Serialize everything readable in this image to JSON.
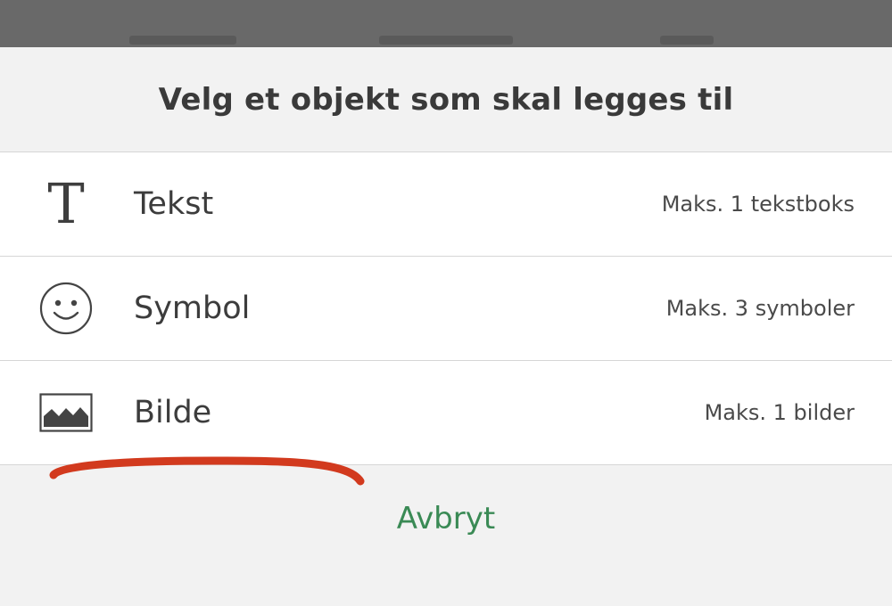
{
  "sheet": {
    "title": "Velg et objekt som skal legges til",
    "options": [
      {
        "label": "Tekst",
        "limit": "Maks. 1 tekstboks",
        "icon": "text-icon"
      },
      {
        "label": "Symbol",
        "limit": "Maks. 3 symboler",
        "icon": "smiley-icon"
      },
      {
        "label": "Bilde",
        "limit": "Maks. 1 bilder",
        "icon": "image-icon"
      }
    ],
    "cancel_label": "Avbryt"
  },
  "colors": {
    "accent": "#3a8a55",
    "annotation": "#d23a1e",
    "backdrop": "#696969"
  }
}
